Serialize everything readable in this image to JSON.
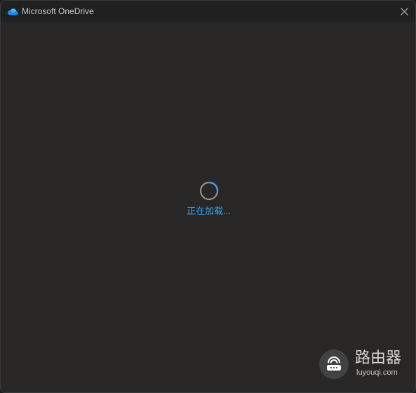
{
  "window": {
    "title": "Microsoft OneDrive",
    "icon": "onedrive-cloud-icon",
    "close_icon": "close-icon",
    "accent_color": "#3f9de6",
    "background_color": "#282726"
  },
  "main": {
    "status_text": "正在加载..."
  },
  "watermark": {
    "title": "路由器",
    "subtitle": "luyouqi.com",
    "icon": "router-logo-icon"
  }
}
